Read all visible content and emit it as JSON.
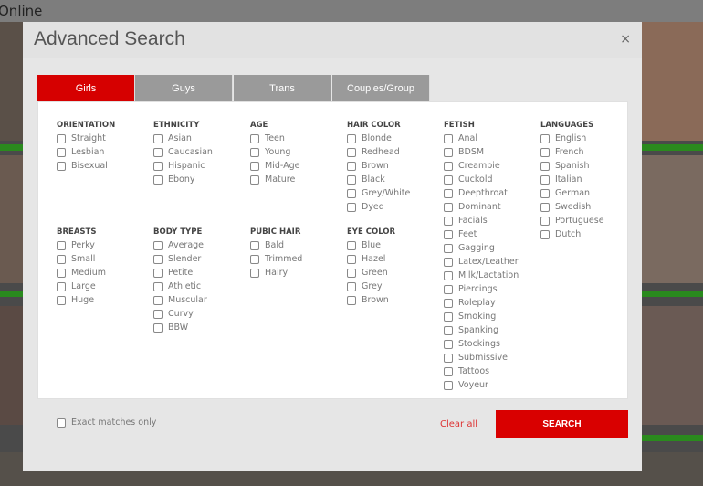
{
  "page": {
    "header_text": "Online"
  },
  "modal": {
    "title": "Advanced Search",
    "close": "×"
  },
  "tabs": [
    {
      "label": "Girls",
      "active": true
    },
    {
      "label": "Guys"
    },
    {
      "label": "Trans"
    },
    {
      "label": "Couples/Group"
    }
  ],
  "groups": [
    {
      "title": "ORIENTATION",
      "options": [
        "Straight",
        "Lesbian",
        "Bisexual"
      ]
    },
    {
      "title": "ETHNICITY",
      "options": [
        "Asian",
        "Caucasian",
        "Hispanic",
        "Ebony"
      ]
    },
    {
      "title": "AGE",
      "options": [
        "Teen",
        "Young",
        "Mid-Age",
        "Mature"
      ]
    },
    {
      "title": "HAIR COLOR",
      "options": [
        "Blonde",
        "Redhead",
        "Brown",
        "Black",
        "Grey/White",
        "Dyed"
      ]
    },
    {
      "title": "FETISH",
      "options": [
        "Anal",
        "BDSM",
        "Creampie",
        "Cuckold",
        "Deepthroat",
        "Dominant",
        "Facials",
        "Feet",
        "Gagging",
        "Latex/Leather",
        "Milk/Lactation",
        "Piercings",
        "Roleplay",
        "Smoking",
        "Spanking",
        "Stockings",
        "Submissive",
        "Tattoos",
        "Voyeur"
      ]
    },
    {
      "title": "LANGUAGES",
      "options": [
        "English",
        "French",
        "Spanish",
        "Italian",
        "German",
        "Swedish",
        "Portuguese",
        "Dutch"
      ]
    },
    {
      "title": "BREASTS",
      "options": [
        "Perky",
        "Small",
        "Medium",
        "Large",
        "Huge"
      ]
    },
    {
      "title": "BODY TYPE",
      "options": [
        "Average",
        "Slender",
        "Petite",
        "Athletic",
        "Muscular",
        "Curvy",
        "BBW"
      ]
    },
    {
      "title": "PUBIC HAIR",
      "options": [
        "Bald",
        "Trimmed",
        "Hairy"
      ]
    },
    {
      "title": "EYE COLOR",
      "options": [
        "Blue",
        "Hazel",
        "Green",
        "Grey",
        "Brown"
      ]
    }
  ],
  "footer": {
    "exact_label": "Exact matches only",
    "clear_label": "Clear all",
    "search_label": "SEARCH"
  },
  "colors": {
    "accent": "#d90000",
    "tab_inactive": "#9a9a9a"
  }
}
